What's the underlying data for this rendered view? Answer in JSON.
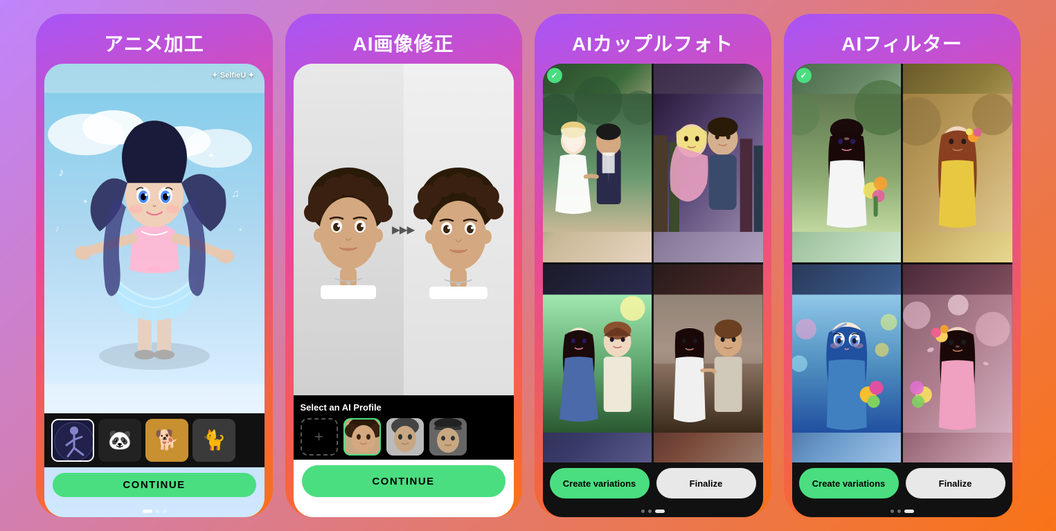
{
  "cards": [
    {
      "id": "card-1",
      "title": "アニメ加工",
      "type": "anime",
      "watermark": "✦ SelfieU ✦",
      "thumbnails": [
        "dancer",
        "panda",
        "shiba",
        "cat"
      ],
      "continue_label": "CONTINUE",
      "dots": [
        true,
        false,
        false
      ]
    },
    {
      "id": "card-2",
      "title": "AI画像修正",
      "type": "correction",
      "profile_title": "Select an AI Profile",
      "continue_label": "CONTINUE",
      "arrows": "▶▶▶",
      "dots": [
        false,
        true,
        false
      ]
    },
    {
      "id": "card-3",
      "title": "AIカップルフォト",
      "type": "couple",
      "create_variations": "Create variations",
      "finalize": "Finalize",
      "dots": [
        false,
        false,
        true
      ]
    },
    {
      "id": "card-4",
      "title": "AIフィルター",
      "type": "filter",
      "create_variations": "Create variations",
      "finalize": "Finalize",
      "dots": [
        false,
        false,
        true
      ]
    }
  ],
  "colors": {
    "green_btn": "#4ade80",
    "white_btn": "#e8e8e8",
    "dark_bg": "#111111"
  }
}
